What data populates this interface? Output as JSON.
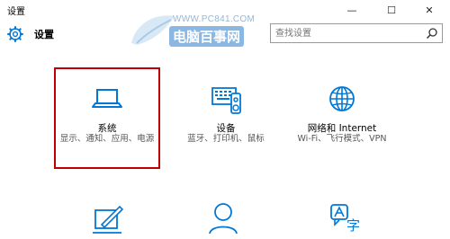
{
  "window": {
    "title": "设置",
    "minimize_glyph": "—",
    "maximize_glyph": "☐",
    "close_glyph": "✕"
  },
  "header": {
    "title": "设置",
    "search": {
      "placeholder": "查找设置"
    }
  },
  "watermark": {
    "url": "WWW.PC841.COM",
    "name": "电脑百事网"
  },
  "tiles": [
    {
      "name": "系统",
      "desc": "显示、通知、应用、电源",
      "icon": "laptop-icon"
    },
    {
      "name": "设备",
      "desc": "蓝牙、打印机、鼠标",
      "icon": "devices-icon"
    },
    {
      "name": "网络和 Internet",
      "desc": "Wi-Fi、飞行模式、VPN",
      "icon": "globe-icon"
    },
    {
      "name": "",
      "desc": "",
      "icon": "personalization-icon"
    },
    {
      "name": "",
      "desc": "",
      "icon": "accounts-icon"
    },
    {
      "name": "",
      "desc": "",
      "icon": "time-language-icon"
    }
  ],
  "colors": {
    "accent": "#0078d7",
    "highlight": "#c00000",
    "watermark": "#8ab8e2"
  }
}
